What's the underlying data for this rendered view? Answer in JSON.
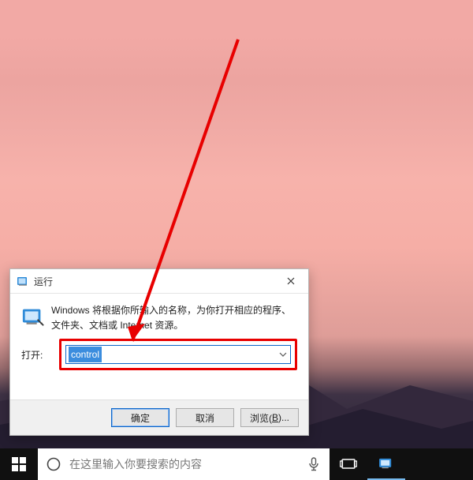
{
  "dialog": {
    "title": "运行",
    "description_line1": "Windows 将根据你所输入的名称，为你打开相应的程序、",
    "description_line2": "文件夹、文档或 Internet 资源。",
    "open_label": "打开:",
    "open_value": "control",
    "buttons": {
      "ok": "确定",
      "cancel": "取消",
      "browse_pre": "浏览(",
      "browse_accel": "B",
      "browse_post": ")..."
    }
  },
  "taskbar": {
    "search_placeholder": "在这里输入你要搜索的内容"
  },
  "icons": {
    "run": "run-icon",
    "close": "close-icon",
    "dropdown": "chevron-down-icon",
    "start": "windows-logo-icon",
    "cortana": "cortana-circle-icon",
    "mic": "microphone-icon",
    "taskview": "task-view-icon"
  },
  "colors": {
    "highlight_border": "#e80000",
    "selection": "#3b8dde"
  }
}
